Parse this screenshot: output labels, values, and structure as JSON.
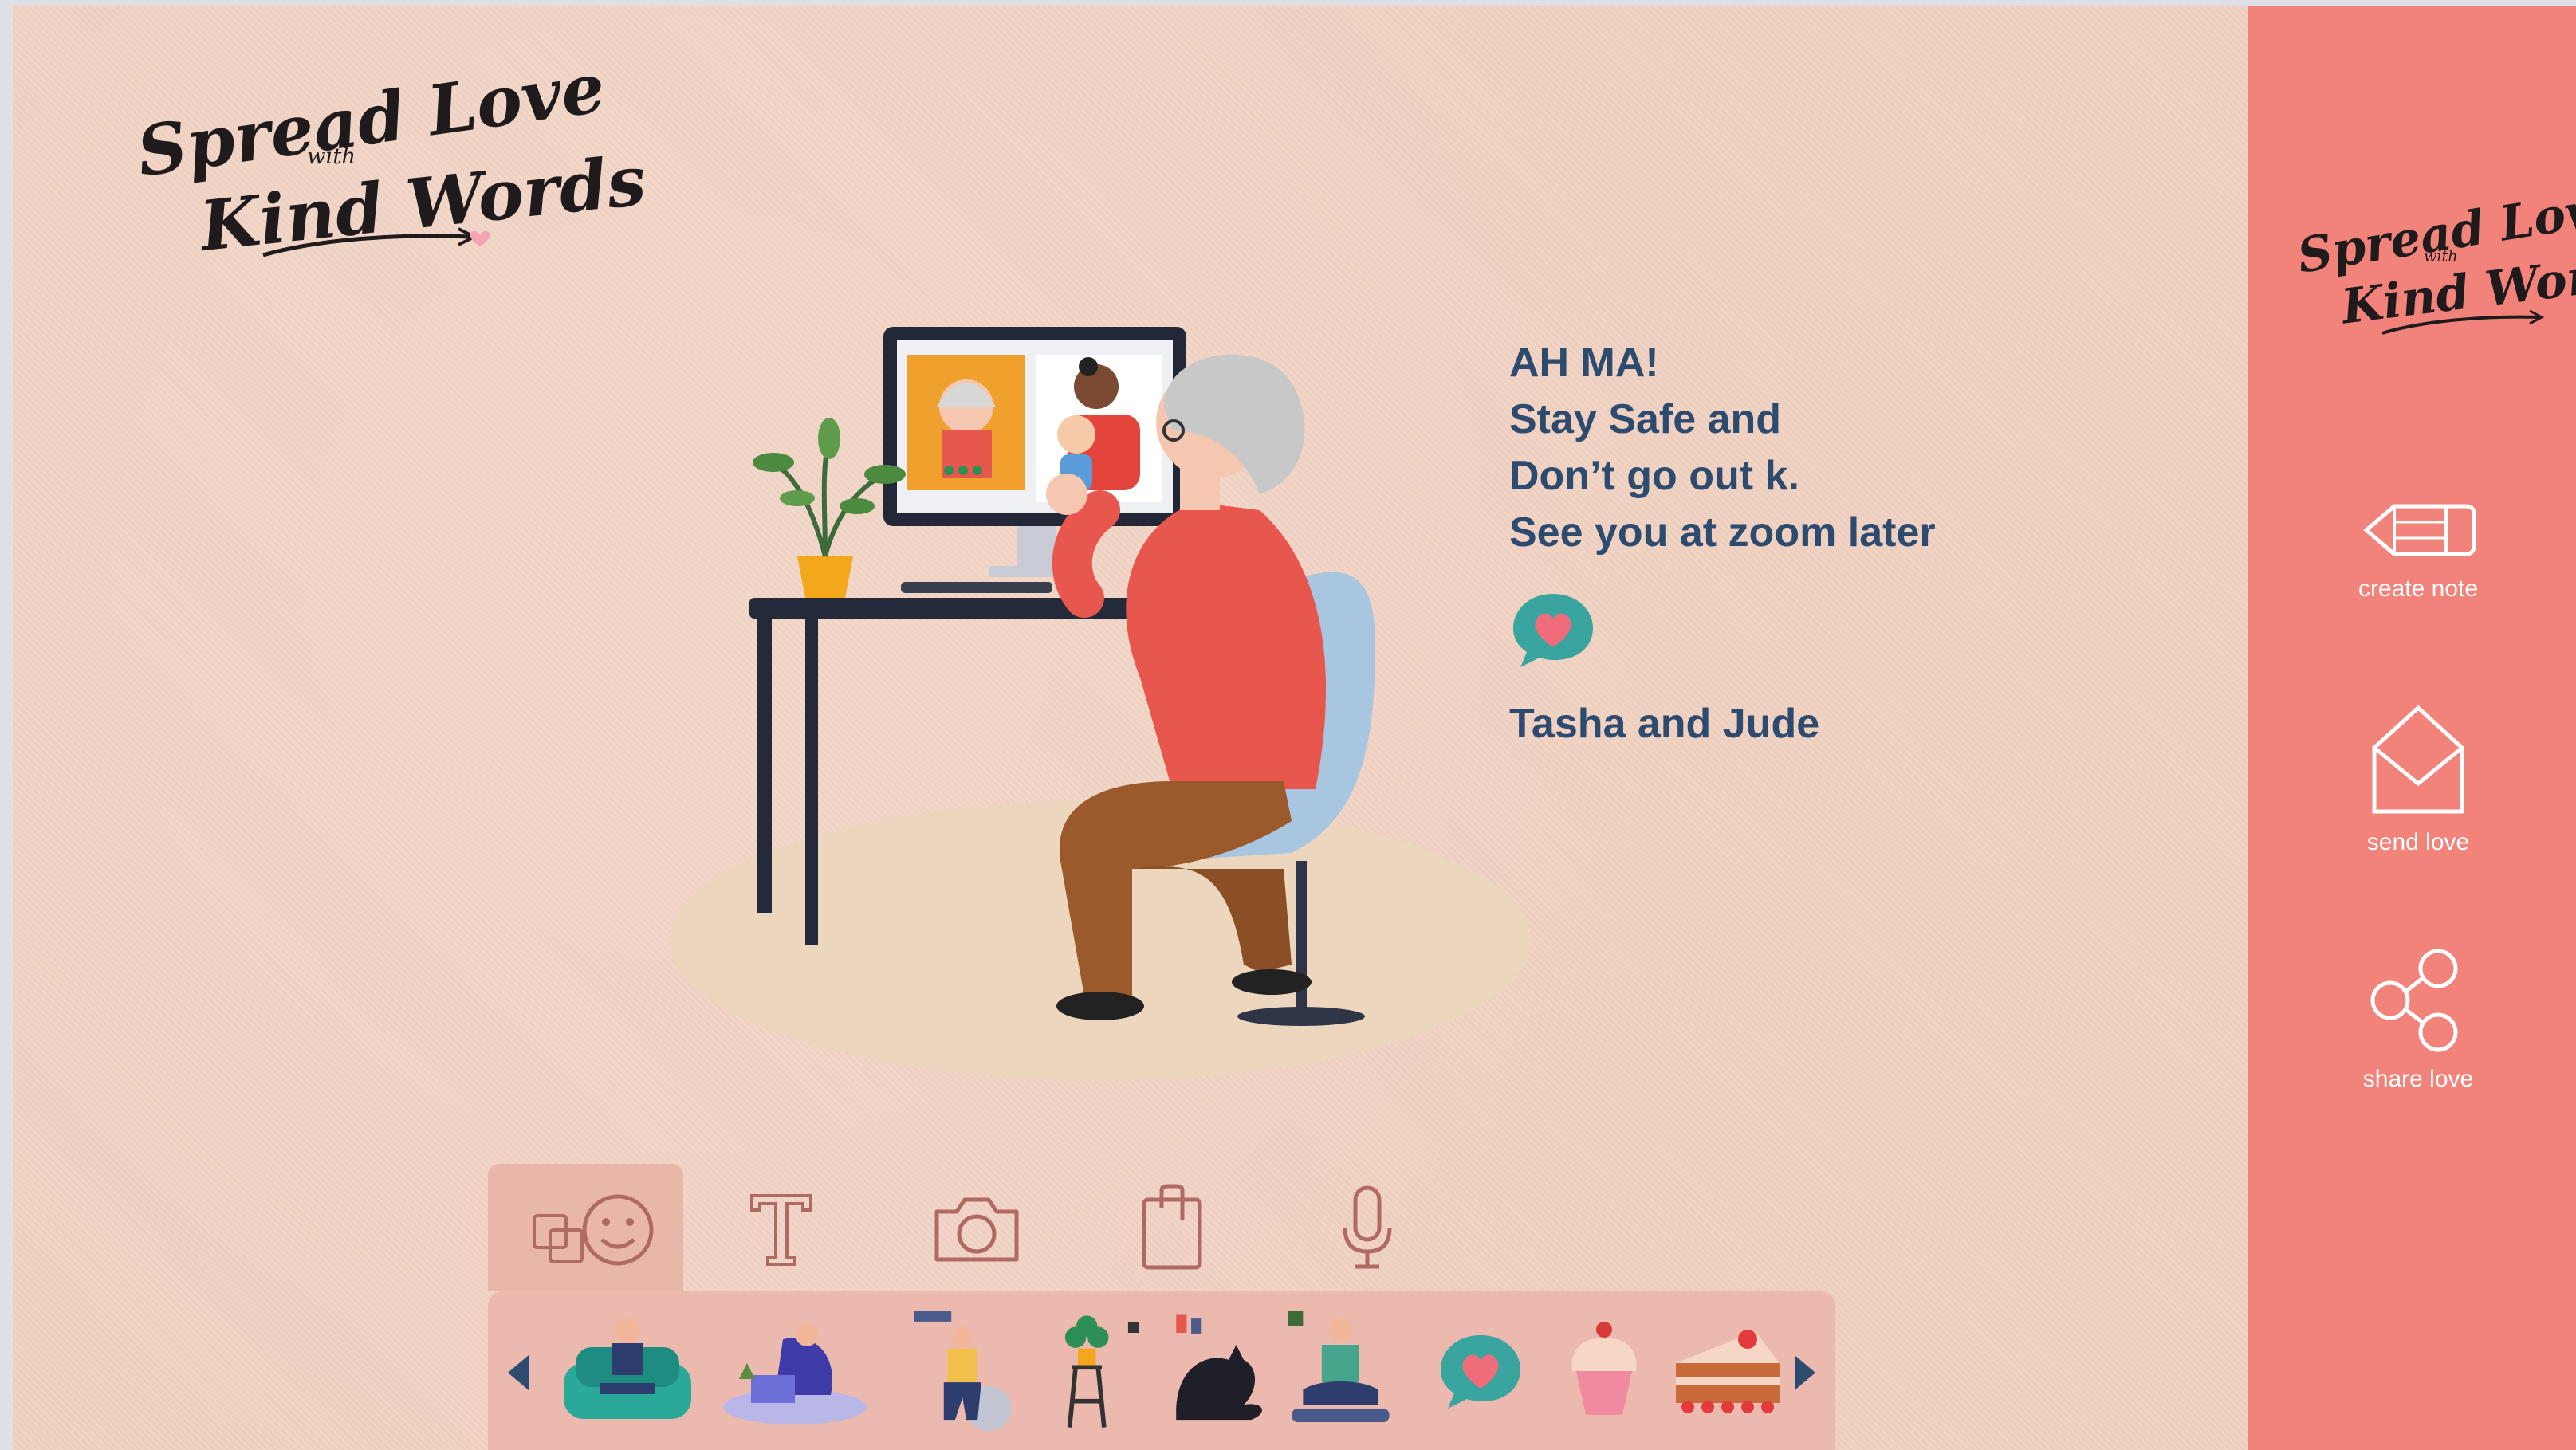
{
  "brand": {
    "logo_line1": "Spread Love",
    "logo_with": "with",
    "logo_line2": "Kind Words"
  },
  "note": {
    "lines": [
      "AH MA!",
      "Stay Safe and",
      "Don’t go out k.",
      "See you at zoom later"
    ],
    "signature": "Tasha and Jude",
    "icon": "heart-speech-bubble-icon"
  },
  "sidebar": {
    "buttons": [
      {
        "label": "create note",
        "icon": "pencil-icon"
      },
      {
        "label": "send love",
        "icon": "envelope-icon"
      },
      {
        "label": "share love",
        "icon": "share-icon"
      }
    ]
  },
  "toolbar": {
    "tools": [
      {
        "name": "stickers",
        "icon": "sticker-smiley-icon",
        "active": true
      },
      {
        "name": "text",
        "icon": "text-icon",
        "active": false
      },
      {
        "name": "camera",
        "icon": "camera-icon",
        "active": false
      },
      {
        "name": "clipboard",
        "icon": "clipboard-icon",
        "active": false
      },
      {
        "name": "voice",
        "icon": "microphone-icon",
        "active": false
      }
    ]
  },
  "stickers": [
    "woman-on-sofa-sticker",
    "woman-with-laptop-sticker",
    "woman-exercise-ball-sticker",
    "plant-stand-sticker",
    "black-cat-sticker",
    "man-yoga-sticker",
    "heart-bubble-sticker",
    "cupcake-sticker",
    "strawberry-cake-sticker"
  ],
  "colors": {
    "canvas": "#f1d2c2",
    "sidebar": "#f2837a",
    "text_navy": "#2d4a6f",
    "icon_outline": "#b06a64",
    "heart_teal": "#3aa59f",
    "heart_pink": "#ef6c7a"
  }
}
